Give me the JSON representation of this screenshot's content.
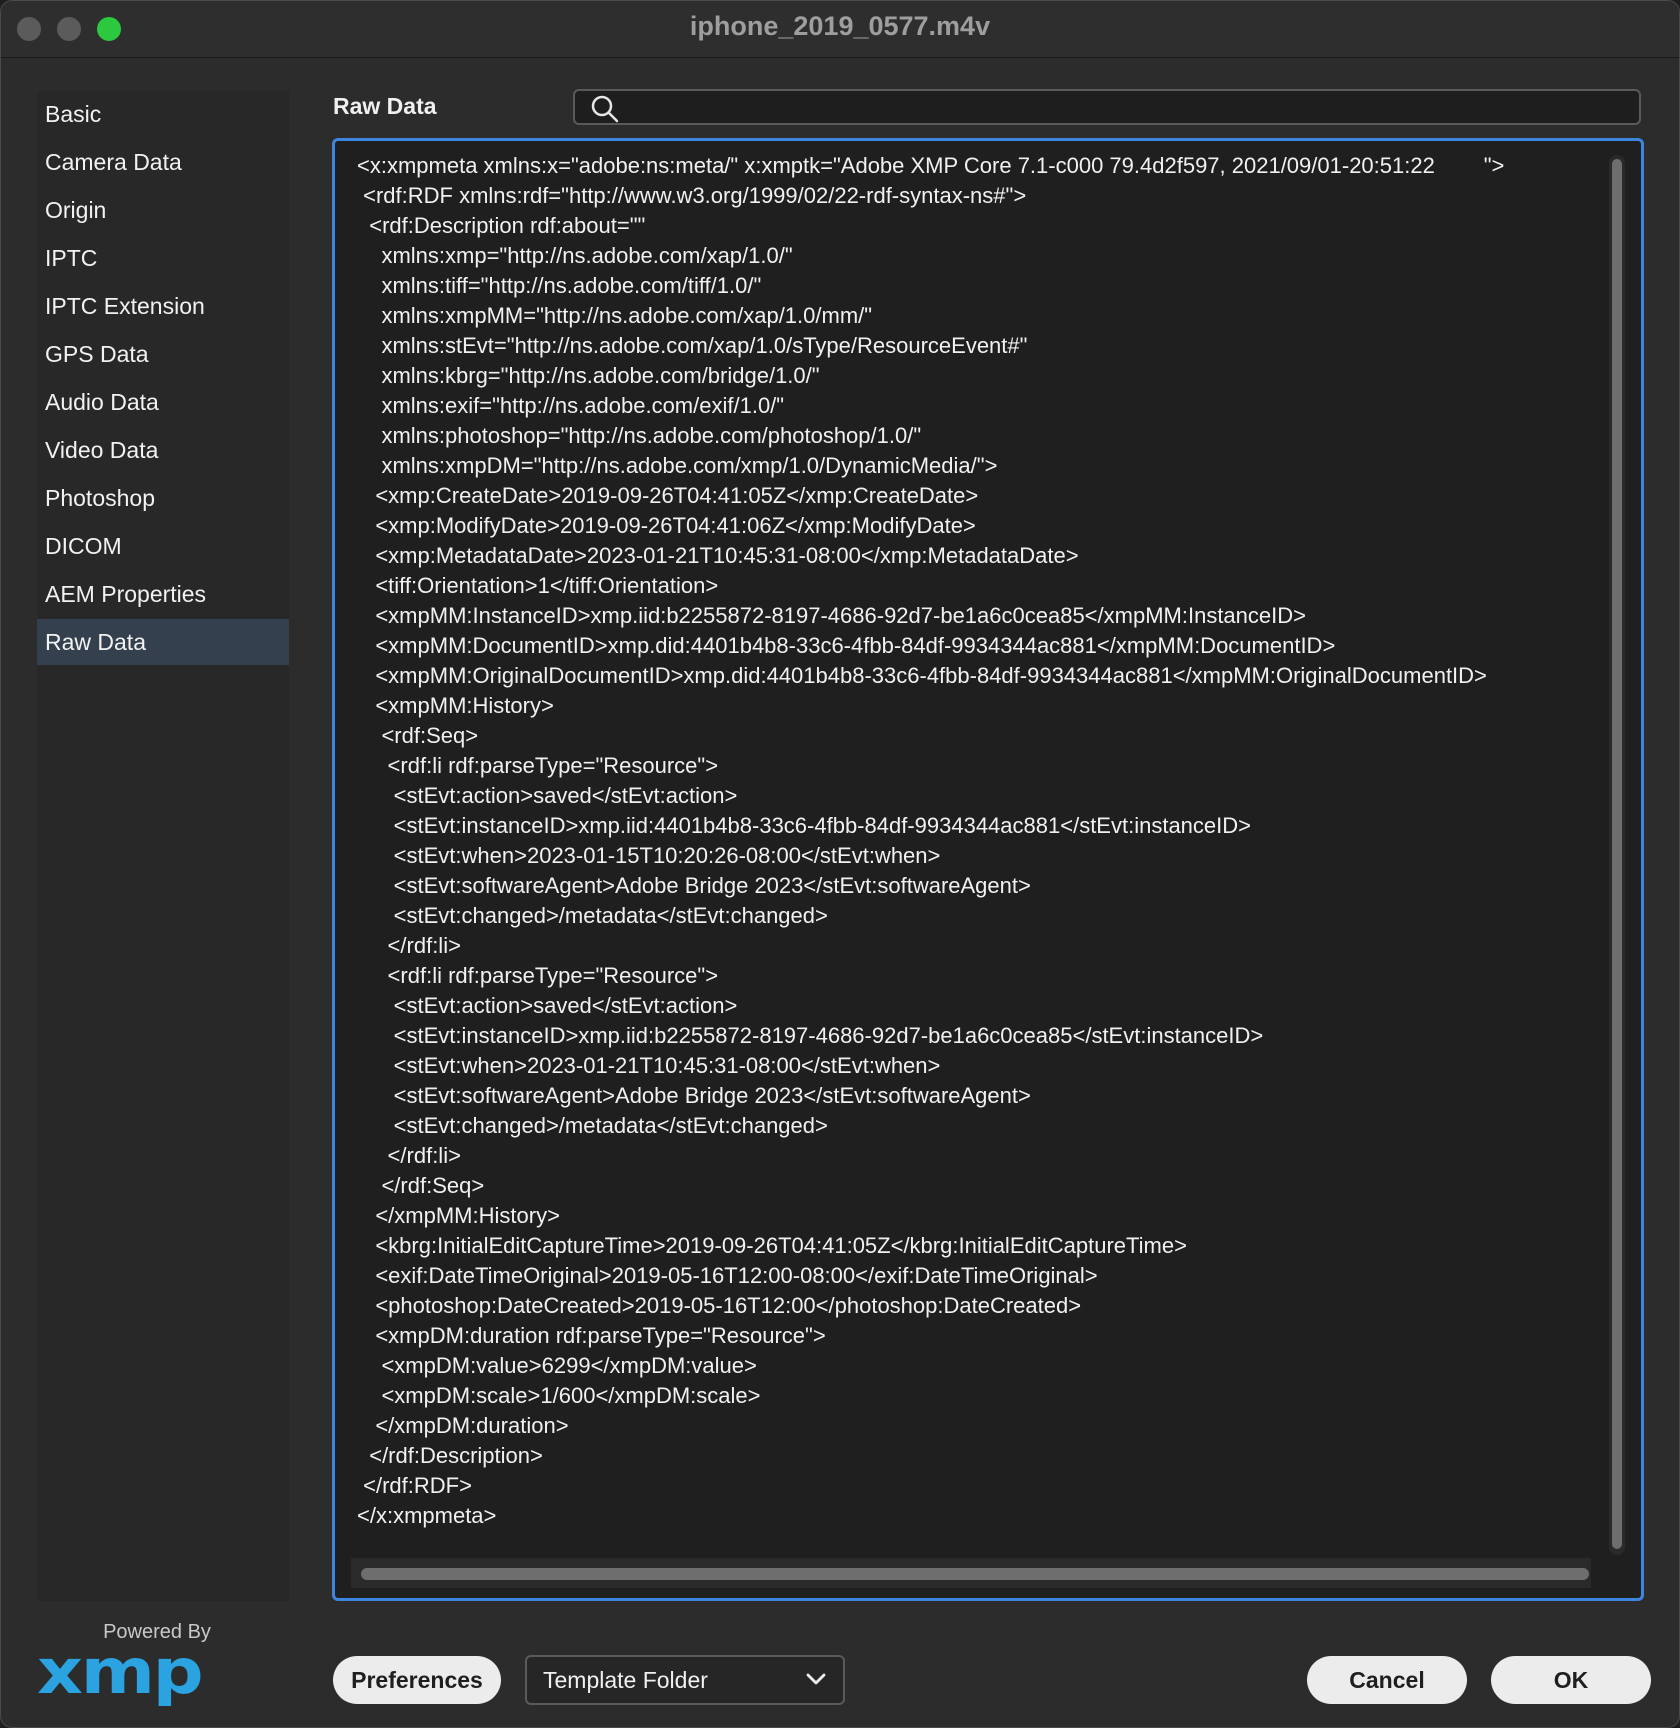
{
  "window": {
    "title": "iphone_2019_0577.m4v"
  },
  "sidebar": {
    "items": [
      {
        "label": "Basic",
        "selected": false
      },
      {
        "label": "Camera Data",
        "selected": false
      },
      {
        "label": "Origin",
        "selected": false
      },
      {
        "label": "IPTC",
        "selected": false
      },
      {
        "label": "IPTC Extension",
        "selected": false
      },
      {
        "label": "GPS Data",
        "selected": false
      },
      {
        "label": "Audio Data",
        "selected": false
      },
      {
        "label": "Video Data",
        "selected": false
      },
      {
        "label": "Photoshop",
        "selected": false
      },
      {
        "label": "DICOM",
        "selected": false
      },
      {
        "label": "AEM Properties",
        "selected": false
      },
      {
        "label": "Raw Data",
        "selected": true
      }
    ]
  },
  "main": {
    "section_label": "Raw Data",
    "search": {
      "value": "",
      "placeholder": ""
    },
    "raw_xml": "<x:xmpmeta xmlns:x=\"adobe:ns:meta/\" x:xmptk=\"Adobe XMP Core 7.1-c000 79.4d2f597, 2021/09/01-20:51:22        \">\n <rdf:RDF xmlns:rdf=\"http://www.w3.org/1999/02/22-rdf-syntax-ns#\">\n  <rdf:Description rdf:about=\"\"\n    xmlns:xmp=\"http://ns.adobe.com/xap/1.0/\"\n    xmlns:tiff=\"http://ns.adobe.com/tiff/1.0/\"\n    xmlns:xmpMM=\"http://ns.adobe.com/xap/1.0/mm/\"\n    xmlns:stEvt=\"http://ns.adobe.com/xap/1.0/sType/ResourceEvent#\"\n    xmlns:kbrg=\"http://ns.adobe.com/bridge/1.0/\"\n    xmlns:exif=\"http://ns.adobe.com/exif/1.0/\"\n    xmlns:photoshop=\"http://ns.adobe.com/photoshop/1.0/\"\n    xmlns:xmpDM=\"http://ns.adobe.com/xmp/1.0/DynamicMedia/\">\n   <xmp:CreateDate>2019-09-26T04:41:05Z</xmp:CreateDate>\n   <xmp:ModifyDate>2019-09-26T04:41:06Z</xmp:ModifyDate>\n   <xmp:MetadataDate>2023-01-21T10:45:31-08:00</xmp:MetadataDate>\n   <tiff:Orientation>1</tiff:Orientation>\n   <xmpMM:InstanceID>xmp.iid:b2255872-8197-4686-92d7-be1a6c0cea85</xmpMM:InstanceID>\n   <xmpMM:DocumentID>xmp.did:4401b4b8-33c6-4fbb-84df-9934344ac881</xmpMM:DocumentID>\n   <xmpMM:OriginalDocumentID>xmp.did:4401b4b8-33c6-4fbb-84df-9934344ac881</xmpMM:OriginalDocumentID>\n   <xmpMM:History>\n    <rdf:Seq>\n     <rdf:li rdf:parseType=\"Resource\">\n      <stEvt:action>saved</stEvt:action>\n      <stEvt:instanceID>xmp.iid:4401b4b8-33c6-4fbb-84df-9934344ac881</stEvt:instanceID>\n      <stEvt:when>2023-01-15T10:20:26-08:00</stEvt:when>\n      <stEvt:softwareAgent>Adobe Bridge 2023</stEvt:softwareAgent>\n      <stEvt:changed>/metadata</stEvt:changed>\n     </rdf:li>\n     <rdf:li rdf:parseType=\"Resource\">\n      <stEvt:action>saved</stEvt:action>\n      <stEvt:instanceID>xmp.iid:b2255872-8197-4686-92d7-be1a6c0cea85</stEvt:instanceID>\n      <stEvt:when>2023-01-21T10:45:31-08:00</stEvt:when>\n      <stEvt:softwareAgent>Adobe Bridge 2023</stEvt:softwareAgent>\n      <stEvt:changed>/metadata</stEvt:changed>\n     </rdf:li>\n    </rdf:Seq>\n   </xmpMM:History>\n   <kbrg:InitialEditCaptureTime>2019-09-26T04:41:05Z</kbrg:InitialEditCaptureTime>\n   <exif:DateTimeOriginal>2019-05-16T12:00-08:00</exif:DateTimeOriginal>\n   <photoshop:DateCreated>2019-05-16T12:00</photoshop:DateCreated>\n   <xmpDM:duration rdf:parseType=\"Resource\">\n    <xmpDM:value>6299</xmpDM:value>\n    <xmpDM:scale>1/600</xmpDM:scale>\n   </xmpDM:duration>\n  </rdf:Description>\n </rdf:RDF>\n</x:xmpmeta>"
  },
  "branding": {
    "powered_by": "Powered By",
    "logo_text": "xmp",
    "logo_color": "#2aa3e0"
  },
  "footer": {
    "preferences_label": "Preferences",
    "template_folder_label": "Template Folder",
    "cancel_label": "Cancel",
    "ok_label": "OK"
  },
  "colors": {
    "accent": "#3d86e0",
    "selected_bg": "#34404e",
    "close_dot": "#5b5b5b",
    "min_dot": "#5b5b5b",
    "max_dot": "#2bc840"
  }
}
